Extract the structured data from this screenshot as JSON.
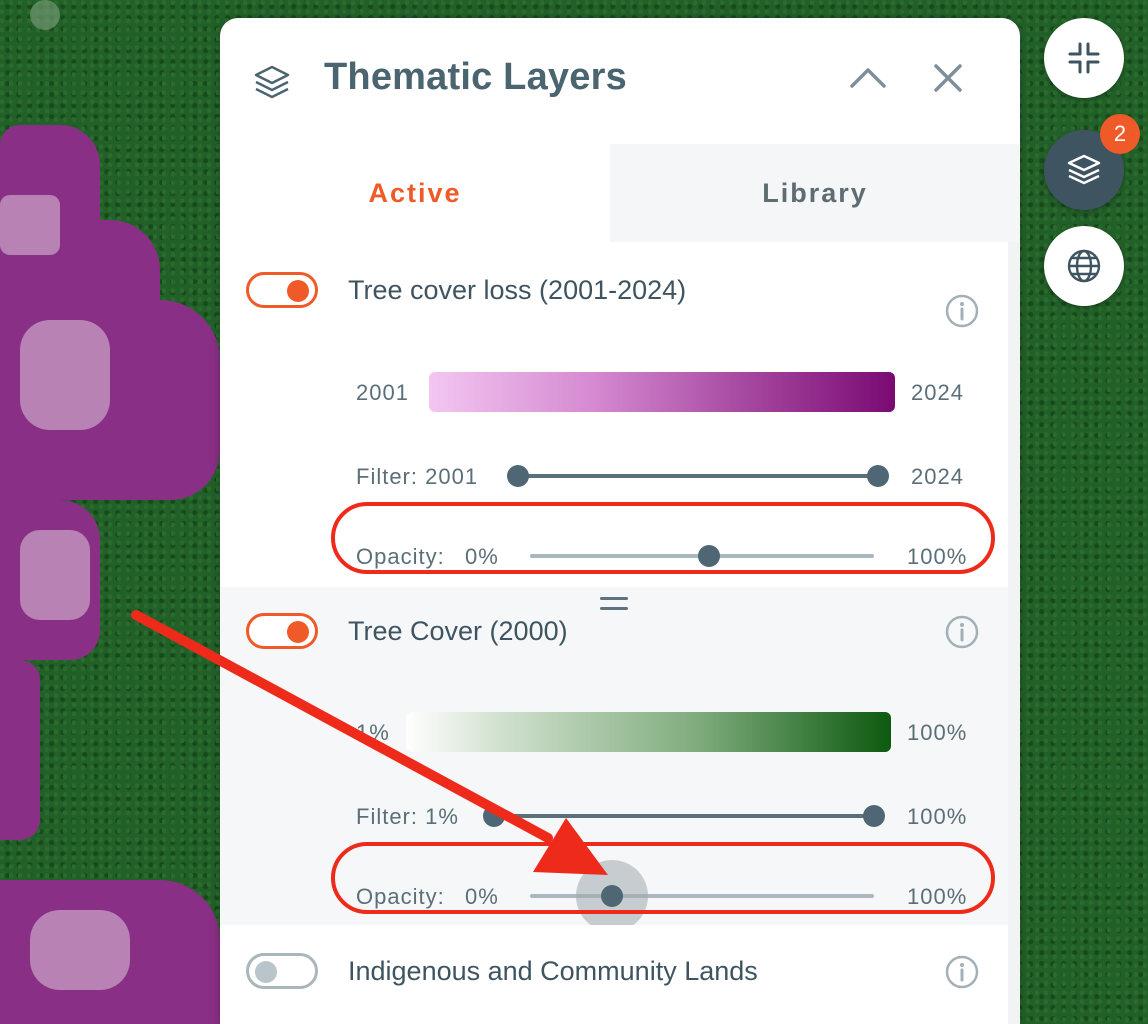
{
  "panel": {
    "title": "Thematic Layers",
    "tabs": [
      {
        "label": "Active",
        "selected": true
      },
      {
        "label": "Library",
        "selected": false
      }
    ]
  },
  "layers": [
    {
      "title": "Tree cover loss (2001-2024)",
      "enabled": true,
      "legend": {
        "min_label": "2001",
        "max_label": "2024",
        "colors": [
          "#f3c6f1",
          "#7a0a72"
        ]
      },
      "filter": {
        "label": "Filter: 2001",
        "max_label": "2024",
        "range": [
          2001,
          2024
        ]
      },
      "opacity": {
        "label": "Opacity:",
        "min_label": "0%",
        "max_label": "100%",
        "value_percent": 52
      }
    },
    {
      "title": "Tree Cover (2000)",
      "enabled": true,
      "legend": {
        "min_label": "1%",
        "max_label": "100%",
        "colors": [
          "#ffffff",
          "#0d5a10"
        ]
      },
      "filter": {
        "label": "Filter: 1%",
        "max_label": "100%",
        "range_percent": [
          1,
          100
        ]
      },
      "opacity": {
        "label": "Opacity:",
        "min_label": "0%",
        "max_label": "100%",
        "value_percent": 24
      }
    },
    {
      "title": "Indigenous and Community Lands",
      "enabled": false
    }
  ],
  "side_controls": {
    "layers_badge": "2",
    "icons": [
      "collapse-icon",
      "layers-icon",
      "globe-icon"
    ]
  },
  "colors": {
    "accent": "#f05a28",
    "panel_text": "#4a6470",
    "annotation": "#ee2a1b"
  }
}
